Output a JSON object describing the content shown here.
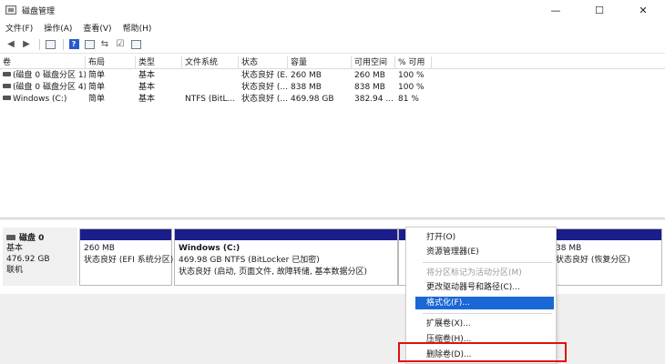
{
  "window": {
    "title": "磁盘管理",
    "minimize": "—",
    "maximize": "☐",
    "close": "✕"
  },
  "menu": [
    "文件(F)",
    "操作(A)",
    "查看(V)",
    "帮助(H)"
  ],
  "columns": [
    "卷",
    "布局",
    "类型",
    "文件系统",
    "状态",
    "容量",
    "可用空间",
    "% 可用"
  ],
  "volumes": [
    {
      "name": "(磁盘 0 磁盘分区 1)",
      "layout": "简单",
      "type": "基本",
      "fs": "",
      "status": "状态良好 (E...",
      "capacity": "260 MB",
      "free": "260 MB",
      "pct": "100 %"
    },
    {
      "name": "(磁盘 0 磁盘分区 4)",
      "layout": "简单",
      "type": "基本",
      "fs": "",
      "status": "状态良好 (...",
      "capacity": "838 MB",
      "free": "838 MB",
      "pct": "100 %"
    },
    {
      "name": "Windows (C:)",
      "layout": "简单",
      "type": "基本",
      "fs": "NTFS (BitL...",
      "status": "状态良好 (...",
      "capacity": "469.98 GB",
      "free": "382.94 ...",
      "pct": "81 %"
    }
  ],
  "disk": {
    "title": "磁盘 0",
    "type": "基本",
    "size": "476.92 GB",
    "status": "联机"
  },
  "partitions": [
    {
      "title": "",
      "line1": "260 MB",
      "line2": "状态良好 (EFI 系统分区)"
    },
    {
      "title": "Windows  (C:)",
      "line1": "469.98 GB NTFS (BitLocker 已加密)",
      "line2": "状态良好 (启动, 页面文件, 故障转储, 基本数据分区)"
    },
    {
      "title": "",
      "line1": "38 MB",
      "line2": "状态良好 (恢复分区)"
    }
  ],
  "context_menu": {
    "open": "打开(O)",
    "explorer": "资源管理器(E)",
    "mark_active": "将分区标记为活动分区(M)",
    "change_letter": "更改驱动器号和路径(C)...",
    "format": "格式化(F)...",
    "extend": "扩展卷(X)...",
    "shrink": "压缩卷(H)...",
    "delete": "删除卷(D)..."
  },
  "colors": {
    "partition_bar": "#1b1e8a",
    "highlight": "#1a67d6",
    "annotation_box": "#e01010"
  }
}
